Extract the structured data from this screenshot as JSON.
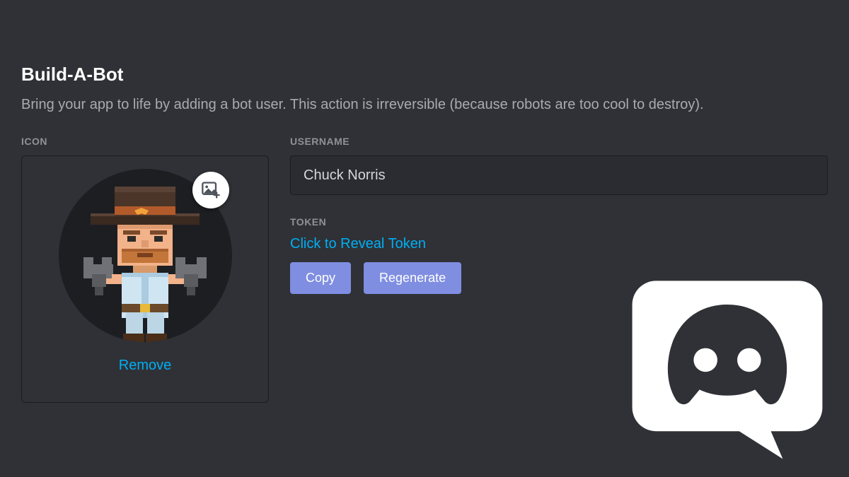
{
  "header": {
    "title": "Build-A-Bot",
    "subtitle": "Bring your app to life by adding a bot user. This action is irreversible (because robots are too cool to destroy)."
  },
  "icon_section": {
    "label": "ICON",
    "remove_label": "Remove",
    "upload_icon": "image-add-icon"
  },
  "username_section": {
    "label": "USERNAME",
    "value": "Chuck Norris"
  },
  "token_section": {
    "label": "TOKEN",
    "reveal_label": "Click to Reveal Token",
    "copy_label": "Copy",
    "regenerate_label": "Regenerate"
  },
  "colors": {
    "background": "#2f3136",
    "accent_link": "#00aff4",
    "button": "#7f8ee1",
    "panel_border": "#1b1c1f",
    "text_muted": "#8e9297"
  }
}
